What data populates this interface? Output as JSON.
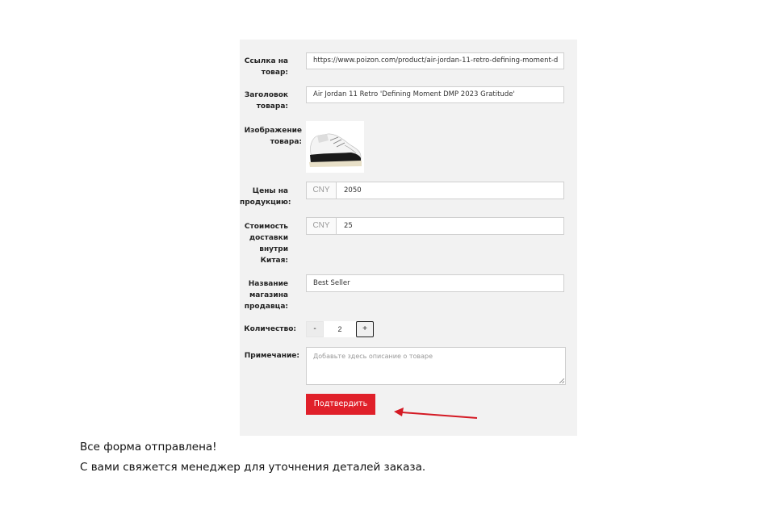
{
  "form": {
    "url_label": "Ссылка на товар:",
    "url_value": "https://www.poizon.com/product/air-jordan-11-retro-defining-moment-d",
    "title_label": "Заголовок товара:",
    "title_value": "Air Jordan 11 Retro 'Defining Moment DMP 2023 Gratitude'",
    "image_label": "Изображение товара:",
    "price_label": "Цены на продукцию:",
    "price_currency": "CNY",
    "price_value": "2050",
    "shipping_label": "Стоимость доставки внутри Китая:",
    "shipping_currency": "CNY",
    "shipping_value": "25",
    "shop_label": "Название магазина продавца:",
    "shop_value": "Best Seller",
    "qty_label": "Количество:",
    "qty_minus": "-",
    "qty_value": "2",
    "qty_plus": "+",
    "note_label": "Примечание:",
    "note_placeholder": "Добавьте здесь описание о товаре",
    "submit_label": "Подтвердить"
  },
  "message": {
    "line1": "Все форма отправлена!",
    "line2": "С вами свяжется менеджер для уточнения деталей заказа."
  },
  "colors": {
    "accent": "#e0202a",
    "panel_bg": "#f2f2f2"
  }
}
